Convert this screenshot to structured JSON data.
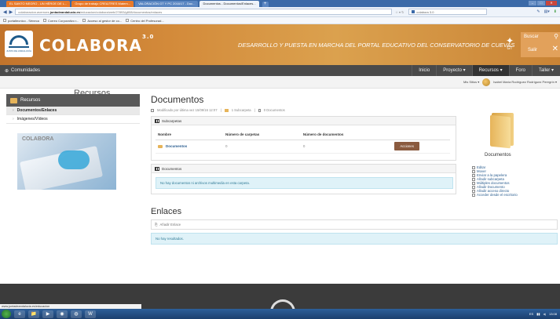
{
  "browser": {
    "tabs": [
      {
        "label": "EL SANTO NEGRO - UN HÉROE DE L...",
        "style": "orange"
      },
      {
        "label": "Grupo de trabajo CREA/TRES Matem...",
        "style": "orange"
      },
      {
        "label": "VALORACIÓN GT Y PC 2016/17 - Doc...",
        "style": "normal"
      },
      {
        "label": "Documentos - Documentos/Enlaces...",
        "style": "active"
      }
    ],
    "new_tab": "+",
    "url_prefix": "colaboracion.averroes.",
    "url_domain": "juntadeandalucia.es",
    "url_rest": "/educacion/colabora/web/27893/g808/documentos/enlaces",
    "search_text": "colabora 3.0",
    "bookmarks": [
      "portaltecnico - Séneca",
      "Correo Corporativo r...",
      "Acceso al gestor de co...",
      "Centro del Profesorad..."
    ]
  },
  "header": {
    "brand": "COLABORA",
    "version": "3.0",
    "logo_caption": "JUNTA DE ANDALUCÍA",
    "slogan": "DESARROLLO Y PUESTA EN MARCHA DEL PORTAL EDUCATIVO DEL CONSERVATORIO DE CUEVAS",
    "badge": "GT",
    "search_label": "Buscar",
    "logout_label": "Salir"
  },
  "navbar": {
    "communities": "Comunidades",
    "items": [
      "Inicio",
      "Proyecto ▾",
      "Recursos ▾",
      "Foro",
      "Taller ▾"
    ],
    "active_index": 2
  },
  "userbar": {
    "sites": "Mis Sitios ▾",
    "user": "Isabel María Rodríguez Rodríguez Peregrín ▾"
  },
  "sidebar": {
    "title": "Recursos",
    "items": [
      {
        "label": "Documentos/Enlaces",
        "selected": true
      },
      {
        "label": "Imágenes/Vídeos",
        "selected": false
      }
    ],
    "banner_logo": "COLABORA",
    "banner_label": "Recursos"
  },
  "main": {
    "title": "Documentos",
    "meta_modified": "Modificado por última vez 15/09/16 12:07",
    "meta_subfolders": "1 Subcarpeta",
    "meta_documents": "0 Documentos",
    "subfolders_panel_title": "Subcarpetas",
    "table_headers": [
      "Nombre",
      "Número de carpetas",
      "Número de documentos"
    ],
    "table_rows": [
      {
        "name": "Documentos",
        "folders": "0",
        "docs": "0",
        "action": "Acciones"
      }
    ],
    "documents_panel_title": "Documentos",
    "documents_empty": "No hay documentos ni archivos multimedia en esta carpeta.",
    "links_title": "Enlaces",
    "add_link": "Añadir Enlace",
    "links_empty": "No hay resultados."
  },
  "rightcol": {
    "folder_title": "Documentos",
    "actions": [
      "Editar",
      "Mover",
      "Enviar a la papelera",
      "Añadir subcarpeta",
      "Múltiples documentos",
      "Añadir Documento",
      "Añadir acceso directo",
      "Acceder desde el escritorio"
    ]
  },
  "statusbar": "www.juntadeandalucia.es/educacion",
  "taskbar": {
    "apps": [
      "e",
      "📁",
      "▶",
      "◉",
      "◍",
      "W"
    ],
    "clock_time": "13:08",
    "tray_lang": "ES"
  }
}
